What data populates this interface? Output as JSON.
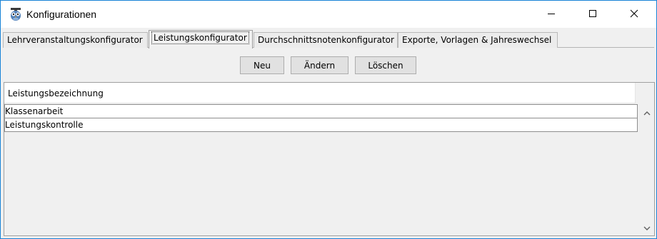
{
  "window": {
    "title": "Konfigurationen",
    "app_icon": "owl-icon",
    "controls": [
      "minimize-icon",
      "maximize-icon",
      "close-icon"
    ]
  },
  "tabs": [
    {
      "label": "Lehrveranstaltungskonfigurator",
      "active": false
    },
    {
      "label": "Leistungskonfigurator",
      "active": true
    },
    {
      "label": "Durchschnittsnotenkonfigurator",
      "active": false
    },
    {
      "label": "Exporte, Vorlagen & Jahreswechsel",
      "active": false
    }
  ],
  "toolbar": {
    "new_label": "Neu",
    "edit_label": "Ändern",
    "delete_label": "Löschen"
  },
  "table": {
    "columns": [
      "Leistungsbezeichnung"
    ],
    "rows": [
      "Klassenarbeit",
      "Leistungskontrolle"
    ]
  },
  "scrollbar": {
    "up_icon": "chevron-up-icon",
    "down_icon": "chevron-down-icon"
  }
}
